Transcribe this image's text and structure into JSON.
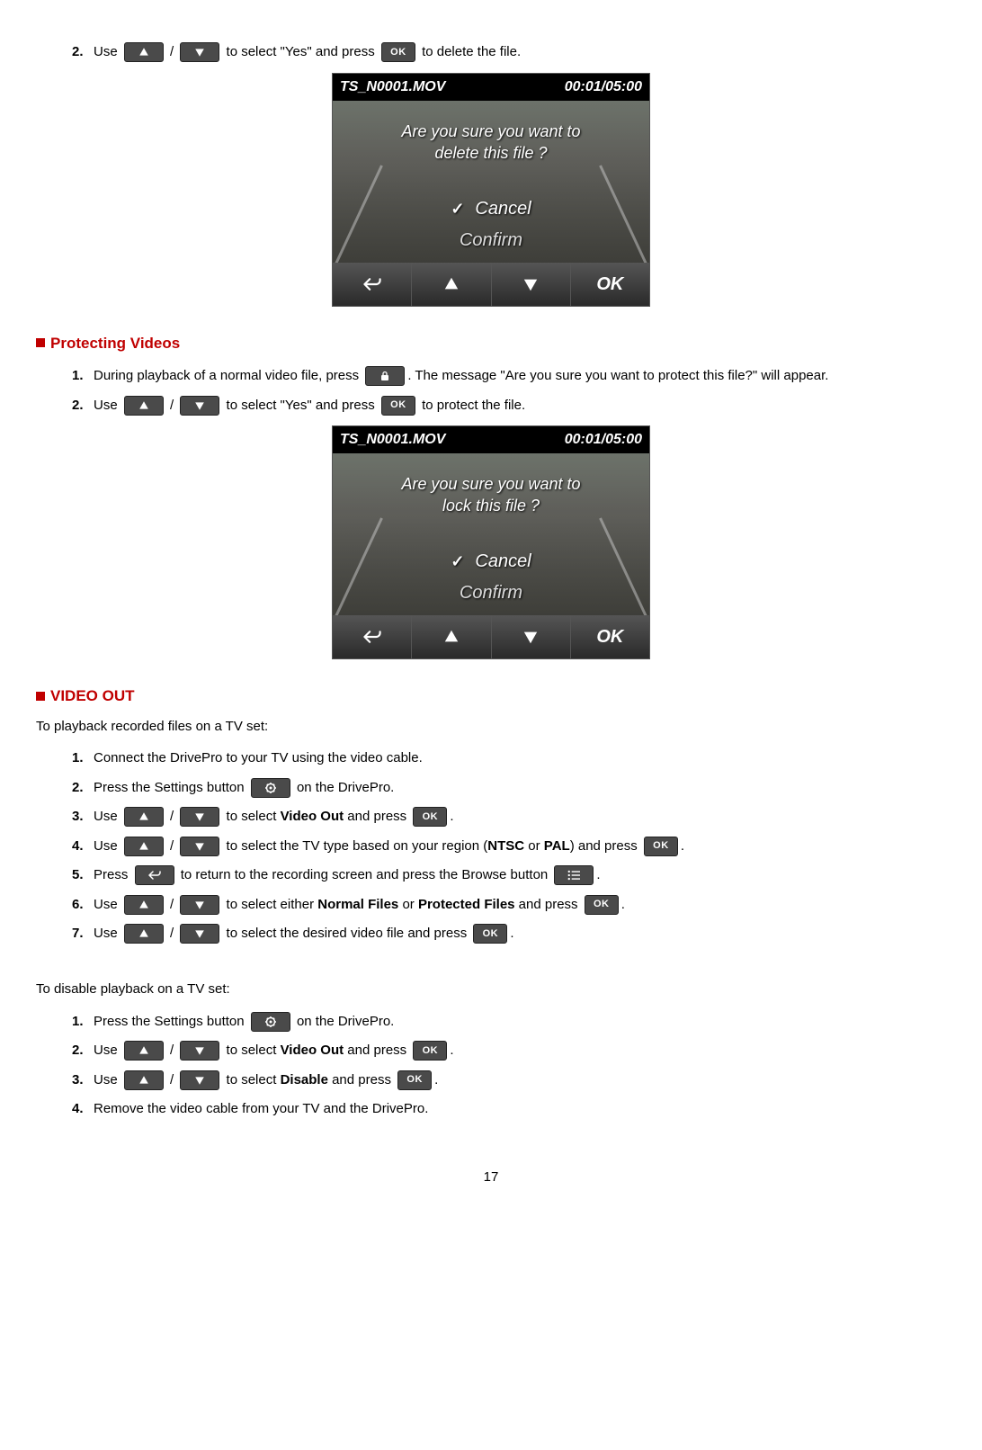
{
  "page_number": "17",
  "top_step": {
    "num": "2.",
    "t1": "Use ",
    "t2": " / ",
    "t3": " to select \"Yes\" and press ",
    "t4": " to delete the file."
  },
  "screenshot1": {
    "filename": "TS_N0001.MOV",
    "time": "00:01/05:00",
    "message_line1": "Are you sure you want to",
    "message_line2": "delete this file ?",
    "cancel": "Cancel",
    "confirm": "Confirm",
    "nav_ok": "OK"
  },
  "section_protecting": {
    "title": "Protecting Videos",
    "step1": {
      "num": "1.",
      "t1": "During playback of a normal video file, press ",
      "t2": ". The message \"Are you sure you want to protect this file?\" will appear."
    },
    "step2": {
      "num": "2.",
      "t1": "Use ",
      "t2": " / ",
      "t3": " to select \"Yes\" and press ",
      "t4": " to protect the file."
    }
  },
  "screenshot2": {
    "filename": "TS_N0001.MOV",
    "time": "00:01/05:00",
    "message_line1": "Are you sure you want to",
    "message_line2": "lock this file ?",
    "cancel": "Cancel",
    "confirm": "Confirm",
    "nav_ok": "OK"
  },
  "section_video_out": {
    "title": "VIDEO OUT",
    "intro": "To playback recorded files on a TV set:",
    "steps": {
      "s1": {
        "num": "1.",
        "t": "Connect the DrivePro to your TV using the video cable."
      },
      "s2": {
        "num": "2.",
        "t1": "Press the Settings button ",
        "t2": " on the DrivePro."
      },
      "s3": {
        "num": "3.",
        "t1": "Use ",
        "t2": " / ",
        "t3": " to select ",
        "bold": "Video Out",
        "t4": " and press ",
        "t5": "."
      },
      "s4": {
        "num": "4.",
        "t1": "Use ",
        "t2": " / ",
        "t3": " to select the TV type based on your region (",
        "b1": "NTSC",
        "t4": " or ",
        "b2": "PAL",
        "t5": ") and press ",
        "t6": "."
      },
      "s5": {
        "num": "5.",
        "t1": "Press ",
        "t2": " to return to the recording screen and press the Browse button ",
        "t3": "."
      },
      "s6": {
        "num": "6.",
        "t1": "Use ",
        "t2": " / ",
        "t3": " to select either ",
        "b1": "Normal Files",
        "t4": " or ",
        "b2": "Protected Files",
        "t5": " and press ",
        "t6": "."
      },
      "s7": {
        "num": "7.",
        "t1": "Use ",
        "t2": " / ",
        "t3": " to select the desired video file and press ",
        "t4": "."
      }
    },
    "disable_intro": "To disable playback on a TV set:",
    "disable_steps": {
      "d1": {
        "num": "1.",
        "t1": "Press the Settings button ",
        "t2": " on the DrivePro."
      },
      "d2": {
        "num": "2.",
        "t1": "Use ",
        "t2": " / ",
        "t3": " to select ",
        "bold": "Video Out",
        "t4": " and press ",
        "t5": "."
      },
      "d3": {
        "num": "3.",
        "t1": "Use ",
        "t2": " / ",
        "t3": " to select ",
        "bold": "Disable",
        "t4": " and press ",
        "t5": "."
      },
      "d4": {
        "num": "4.",
        "t": "Remove the video cable from your TV and the DrivePro."
      }
    }
  },
  "buttons": {
    "ok": "OK"
  }
}
